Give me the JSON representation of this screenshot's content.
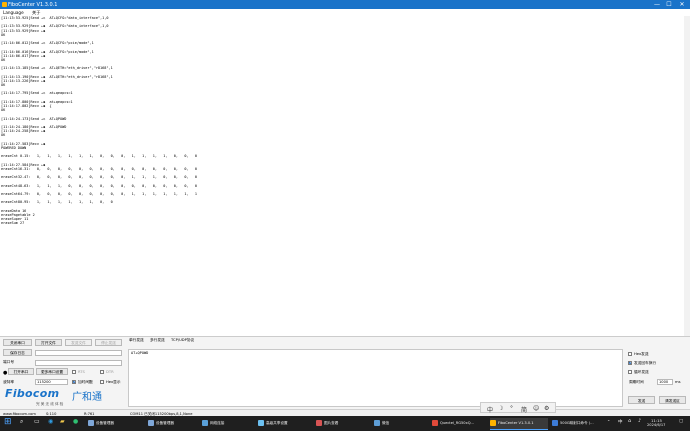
{
  "window": {
    "title": "FiboCenter V1.3.0.1",
    "minimize": "—",
    "maximize": "☐",
    "close": "✕"
  },
  "menu": {
    "language": "Language",
    "about": "关于"
  },
  "log_lines": [
    "[11:13:53.925]Send →◇  AT+QCFG=\"data_interface\",1,0",
    "",
    "[11:13:53.929]Recv ←◆  AT+QCFG=\"data_interface\",1,0",
    "[11:13:53.929]Recv ←◆",
    "OK",
    "",
    "[11:14:06.012]Send →◇  AT+QCFG=\"pcie/mode\",1",
    "",
    "[11:14:06.016]Recv ←◆  AT+QCFG=\"pcie/mode\",1",
    "[11:14:06.017]Recv ←◆",
    "OK",
    "",
    "[11:14:13.185]Send →◇  AT+QETH=\"eth_driver\",\"r8168\",1",
    "",
    "[11:14:13.190]Recv ←◆  AT+QETH=\"eth_driver\",\"r8168\",1",
    "[11:14:13.226]Recv ←◆",
    "OK",
    "",
    "[11:14:17.795]Send →◇  at+qeapcs=1",
    "",
    "[11:14:17.800]Recv ←◆  at+qeapcs=1",
    "[11:14:17.802]Recv ←◆  {",
    "OK",
    "",
    "[11:14:24.173]Send →◇  AT+QPOWD",
    "",
    "[11:14:24.180]Recv ←◆  AT+QPOWD",
    "[11:14:24.258]Recv ←◆",
    "OK",
    "",
    "[11:14:27.583]Recv ←◆",
    "POWERED DOWN",
    "",
    "eraseCnt 0-15:   1,   1,   1,   1,   1,   1,   0,   0,   0,   1,   1,   1,   1,   0,   0,   0",
    "",
    "[11:14:27.584]Recv ←◆",
    "eraseCnt16-31:   0,   0,   0,   0,   0,   0,   0,   0,   0,   0,   0,   0,   0,   0,   0,   0",
    "",
    "eraseCnt32-47:   0,   0,   0,   0,   0,   0,   0,   0,   0,   1,   1,   1,   0,   0,   0,   0",
    "",
    "eraseCnt48-63:   1,   1,   1,   0,   0,   0,   0,   0,   0,   0,   0,   0,   0,   0,   0,   0",
    "",
    "eraseCnt64-79:   0,   0,   0,   0,   0,   0,   0,   0,   0,   1,   1,   1,   1,   1,   1,   1",
    "",
    "eraseCnt80-95:   1,   1,   1,   1,   1,   1,   0,   0",
    "",
    "eraseData 16",
    "erasePagetable 2",
    "eraseSuper 11",
    "eraseSum 27"
  ],
  "controls": {
    "close_port": "关闭串口",
    "open_file": "打开文件",
    "send_file": "发送文件",
    "stop_send": "停止发送",
    "save_log": "保存日志",
    "port_label": "端口号",
    "open_port": "打开串口",
    "more_settings": "更多串口设置",
    "rts": "RTS",
    "dtr": "DTR",
    "baud_label": "波特率",
    "baud_value": "115200",
    "timestamp": "加时间戳",
    "hex_display": "Hex显示"
  },
  "logo": {
    "brand": "Fibocom",
    "cn": "广和通",
    "slogan": "完  美  无  线  体  验"
  },
  "tabs": {
    "single": "单行发送",
    "multi": "多行发送",
    "tcp": "TCP/UDP协议"
  },
  "command": {
    "text": "AT+QPOWD"
  },
  "send_options": {
    "hex_send": "Hex发送",
    "send_newline": "发送回车换行",
    "loop_send": "循环发送",
    "period_label": "周期时间",
    "period_value": "1000",
    "period_unit": "ms",
    "send": "发送",
    "clear": "清发送区"
  },
  "status": {
    "url": "www.fibocom.com",
    "s1": "S:110",
    "r": "R:761",
    "port_status": "COM11 已关闭115200bps,8,1,None"
  },
  "taskbar": {
    "items": [
      {
        "label": "设备管理器",
        "color": "#7fa7d8"
      },
      {
        "label": "设备管理器",
        "color": "#7fa7d8"
      },
      {
        "label": "网络连接",
        "color": "#5aa0d8"
      },
      {
        "label": "高级共享设置",
        "color": "#6cc0f0"
      },
      {
        "label": "图片查看",
        "color": "#d85454"
      },
      {
        "label": "微信",
        "color": "#5e9ed6"
      },
      {
        "label": "Quectel_RG50xQ...",
        "color": "#e04a3a"
      },
      {
        "label": "FiboCenter V1.3.0.1",
        "color": "#ffb300"
      },
      {
        "label": "500G映射口命令 (...",
        "color": "#3d7bd6"
      }
    ],
    "tray": {
      "lang": "中",
      "clock": "11:15",
      "date": "2024/6/17"
    }
  },
  "float_bar": {
    "i1": "中",
    "i2": "☽",
    "i3": "°",
    "i4": "简",
    "i5": "☺",
    "i6": "⚙"
  },
  "colors": {
    "accent": "#1a73c9",
    "logo_blue": "#1a73c9"
  }
}
